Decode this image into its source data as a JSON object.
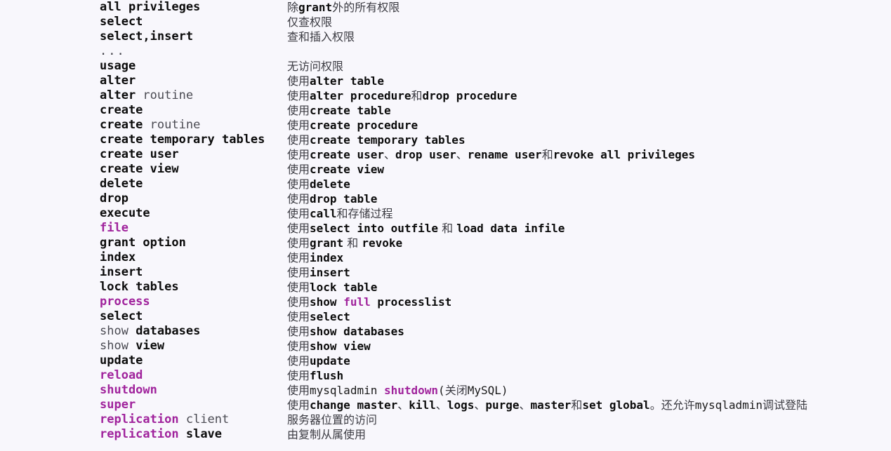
{
  "page": {
    "background_color": "#f8f7fc",
    "keyword_color": "#0b0b0b",
    "highlight_color": "#a0239c",
    "dim_color": "#4a4a52",
    "chinese_color": "#3b3b42"
  },
  "rows": [
    {
      "id": "all-privileges",
      "left_plain": "all privileges",
      "right_plain": "除grant外的所有权限",
      "left_parts": [
        {
          "text": "all privileges",
          "style": "kw"
        }
      ],
      "right_parts": [
        {
          "text": "除",
          "style": "cn"
        },
        {
          "text": "grant",
          "style": "kw"
        },
        {
          "text": "外的所有权限",
          "style": "cn"
        }
      ]
    },
    {
      "id": "select-top",
      "left_plain": "select",
      "right_plain": "仅查权限",
      "left_parts": [
        {
          "text": "select",
          "style": "kw"
        }
      ],
      "right_parts": [
        {
          "text": "仅查权限",
          "style": "cn"
        }
      ]
    },
    {
      "id": "select-insert",
      "left_plain": "select,insert",
      "right_plain": "查和插入权限",
      "left_parts": [
        {
          "text": "select,insert",
          "style": "kw"
        }
      ],
      "right_parts": [
        {
          "text": "查和插入权限",
          "style": "cn"
        }
      ]
    },
    {
      "id": "ellipsis",
      "left_plain": "...",
      "right_plain": "",
      "left_parts": [
        {
          "text": "...",
          "style": "ellipsis"
        }
      ],
      "right_parts": []
    },
    {
      "id": "usage",
      "left_plain": "usage",
      "right_plain": "无访问权限",
      "left_parts": [
        {
          "text": "usage",
          "style": "kw"
        }
      ],
      "right_parts": [
        {
          "text": "无访问权限",
          "style": "cn"
        }
      ]
    },
    {
      "id": "alter",
      "left_plain": "alter",
      "right_plain": "使用alter table",
      "left_parts": [
        {
          "text": "alter",
          "style": "kw"
        }
      ],
      "right_parts": [
        {
          "text": "使用",
          "style": "cn"
        },
        {
          "text": "alter table",
          "style": "kw"
        }
      ]
    },
    {
      "id": "alter-routine",
      "left_plain": "alter routine",
      "right_plain": "使用alter procedure和drop procedure",
      "left_parts": [
        {
          "text": "alter",
          "style": "kw"
        },
        {
          "text": " routine",
          "style": "dim"
        }
      ],
      "right_parts": [
        {
          "text": "使用",
          "style": "cn"
        },
        {
          "text": "alter procedure",
          "style": "kw"
        },
        {
          "text": "和",
          "style": "cn"
        },
        {
          "text": "drop procedure",
          "style": "kw"
        }
      ]
    },
    {
      "id": "create",
      "left_plain": "create",
      "right_plain": "使用create table",
      "left_parts": [
        {
          "text": "create",
          "style": "kw"
        }
      ],
      "right_parts": [
        {
          "text": "使用",
          "style": "cn"
        },
        {
          "text": "create table",
          "style": "kw"
        }
      ]
    },
    {
      "id": "create-routine",
      "left_plain": "create routine",
      "right_plain": "使用create procedure",
      "left_parts": [
        {
          "text": "create",
          "style": "kw"
        },
        {
          "text": " routine",
          "style": "dim"
        }
      ],
      "right_parts": [
        {
          "text": "使用",
          "style": "cn"
        },
        {
          "text": "create procedure",
          "style": "kw"
        }
      ]
    },
    {
      "id": "create-temporary-tables",
      "left_plain": "create temporary tables",
      "right_plain": "使用create temporary tables",
      "left_parts": [
        {
          "text": "create temporary tables",
          "style": "kw"
        }
      ],
      "right_parts": [
        {
          "text": "使用",
          "style": "cn"
        },
        {
          "text": "create temporary tables",
          "style": "kw"
        }
      ]
    },
    {
      "id": "create-user",
      "left_plain": "create user",
      "right_plain": "使用create user、drop user、rename user和revoke  all privileges",
      "left_parts": [
        {
          "text": "create user",
          "style": "kw"
        }
      ],
      "right_parts": [
        {
          "text": "使用",
          "style": "cn"
        },
        {
          "text": "create user",
          "style": "kw"
        },
        {
          "text": "、",
          "style": "cn"
        },
        {
          "text": "drop user",
          "style": "kw"
        },
        {
          "text": "、",
          "style": "cn"
        },
        {
          "text": "rename user",
          "style": "kw"
        },
        {
          "text": "和",
          "style": "cn"
        },
        {
          "text": "revoke  all privileges",
          "style": "kw"
        }
      ]
    },
    {
      "id": "create-view",
      "left_plain": "create view",
      "right_plain": "使用create view",
      "left_parts": [
        {
          "text": "create view",
          "style": "kw"
        }
      ],
      "right_parts": [
        {
          "text": "使用",
          "style": "cn"
        },
        {
          "text": "create view",
          "style": "kw"
        }
      ]
    },
    {
      "id": "delete",
      "left_plain": "delete",
      "right_plain": "使用delete",
      "left_parts": [
        {
          "text": "delete",
          "style": "kw"
        }
      ],
      "right_parts": [
        {
          "text": "使用",
          "style": "cn"
        },
        {
          "text": "delete",
          "style": "kw"
        }
      ]
    },
    {
      "id": "drop",
      "left_plain": "drop",
      "right_plain": "使用drop table",
      "left_parts": [
        {
          "text": "drop",
          "style": "kw"
        }
      ],
      "right_parts": [
        {
          "text": "使用",
          "style": "cn"
        },
        {
          "text": "drop table",
          "style": "kw"
        }
      ]
    },
    {
      "id": "execute",
      "left_plain": "execute",
      "right_plain": "使用call和存储过程",
      "left_parts": [
        {
          "text": "execute",
          "style": "kw"
        }
      ],
      "right_parts": [
        {
          "text": "使用",
          "style": "cn"
        },
        {
          "text": "call",
          "style": "kw"
        },
        {
          "text": "和存储过程",
          "style": "cn"
        }
      ]
    },
    {
      "id": "file",
      "left_plain": "file",
      "right_plain": "使用select into outfile 和 load data infile",
      "left_parts": [
        {
          "text": "file",
          "style": "purple"
        }
      ],
      "right_parts": [
        {
          "text": "使用",
          "style": "cn"
        },
        {
          "text": "select into outfile",
          "style": "kw"
        },
        {
          "text": " 和 ",
          "style": "cn"
        },
        {
          "text": "load data infile",
          "style": "kw"
        }
      ]
    },
    {
      "id": "grant-option",
      "left_plain": "grant option",
      "right_plain": "使用grant 和 revoke",
      "left_parts": [
        {
          "text": "grant option",
          "style": "kw"
        }
      ],
      "right_parts": [
        {
          "text": "使用",
          "style": "cn"
        },
        {
          "text": "grant",
          "style": "kw"
        },
        {
          "text": " 和 ",
          "style": "cn"
        },
        {
          "text": "revoke",
          "style": "kw"
        }
      ]
    },
    {
      "id": "index",
      "left_plain": "index",
      "right_plain": "使用index",
      "left_parts": [
        {
          "text": "index",
          "style": "kw"
        }
      ],
      "right_parts": [
        {
          "text": "使用",
          "style": "cn"
        },
        {
          "text": "index",
          "style": "kw"
        }
      ]
    },
    {
      "id": "insert",
      "left_plain": "insert",
      "right_plain": "使用insert",
      "left_parts": [
        {
          "text": "insert",
          "style": "kw"
        }
      ],
      "right_parts": [
        {
          "text": "使用",
          "style": "cn"
        },
        {
          "text": "insert",
          "style": "kw"
        }
      ]
    },
    {
      "id": "lock-tables",
      "left_plain": "lock tables",
      "right_plain": "使用lock table",
      "left_parts": [
        {
          "text": "lock tables",
          "style": "kw"
        }
      ],
      "right_parts": [
        {
          "text": "使用",
          "style": "cn"
        },
        {
          "text": "lock table",
          "style": "kw"
        }
      ]
    },
    {
      "id": "process",
      "left_plain": "process",
      "right_plain": "使用show full processlist",
      "left_parts": [
        {
          "text": "process",
          "style": "purple"
        }
      ],
      "right_parts": [
        {
          "text": "使用",
          "style": "cn"
        },
        {
          "text": "show ",
          "style": "kw"
        },
        {
          "text": "full",
          "style": "purple"
        },
        {
          "text": " processlist",
          "style": "kw"
        }
      ]
    },
    {
      "id": "select",
      "left_plain": "select",
      "right_plain": "使用select",
      "left_parts": [
        {
          "text": "select",
          "style": "kw"
        }
      ],
      "right_parts": [
        {
          "text": "使用",
          "style": "cn"
        },
        {
          "text": "select",
          "style": "kw"
        }
      ]
    },
    {
      "id": "show-databases",
      "left_plain": "show databases",
      "right_plain": "使用show databases",
      "left_parts": [
        {
          "text": "show ",
          "style": "dim"
        },
        {
          "text": "databases",
          "style": "kw"
        }
      ],
      "right_parts": [
        {
          "text": "使用",
          "style": "cn"
        },
        {
          "text": "show databases",
          "style": "kw"
        }
      ]
    },
    {
      "id": "show-view",
      "left_plain": "show view",
      "right_plain": "使用show view",
      "left_parts": [
        {
          "text": "show ",
          "style": "dim"
        },
        {
          "text": "view",
          "style": "kw"
        }
      ],
      "right_parts": [
        {
          "text": "使用",
          "style": "cn"
        },
        {
          "text": "show view",
          "style": "kw"
        }
      ]
    },
    {
      "id": "update",
      "left_plain": "update",
      "right_plain": "使用update",
      "left_parts": [
        {
          "text": "update",
          "style": "kw"
        }
      ],
      "right_parts": [
        {
          "text": "使用",
          "style": "cn"
        },
        {
          "text": "update",
          "style": "kw"
        }
      ]
    },
    {
      "id": "reload",
      "left_plain": "reload",
      "right_plain": "使用flush",
      "left_parts": [
        {
          "text": "reload",
          "style": "purple"
        }
      ],
      "right_parts": [
        {
          "text": "使用",
          "style": "cn"
        },
        {
          "text": "flush",
          "style": "kw"
        }
      ]
    },
    {
      "id": "shutdown",
      "left_plain": "shutdown",
      "right_plain": "使用mysqladmin shutdown(关闭MySQL)",
      "left_parts": [
        {
          "text": "shutdown",
          "style": "purple"
        }
      ],
      "right_parts": [
        {
          "text": "使用",
          "style": "cn"
        },
        {
          "text": "mysqladmin ",
          "style": "plain"
        },
        {
          "text": "shutdown",
          "style": "purple"
        },
        {
          "text": "(",
          "style": "plain"
        },
        {
          "text": "关闭",
          "style": "cn"
        },
        {
          "text": "MySQL)",
          "style": "plain"
        }
      ]
    },
    {
      "id": "super",
      "left_plain": "super",
      "right_plain": "使用change master、kill、logs、purge、master和set global。还允许mysqladmin调试登陆",
      "left_parts": [
        {
          "text": "super",
          "style": "purple"
        }
      ],
      "right_parts": [
        {
          "text": "使用",
          "style": "cn"
        },
        {
          "text": "change master",
          "style": "kw"
        },
        {
          "text": "、",
          "style": "cn"
        },
        {
          "text": "kill",
          "style": "kw"
        },
        {
          "text": "、",
          "style": "cn"
        },
        {
          "text": "logs",
          "style": "kw"
        },
        {
          "text": "、",
          "style": "cn"
        },
        {
          "text": "purge",
          "style": "kw"
        },
        {
          "text": "、",
          "style": "cn"
        },
        {
          "text": "master",
          "style": "kw"
        },
        {
          "text": "和",
          "style": "cn"
        },
        {
          "text": "set global",
          "style": "kw"
        },
        {
          "text": "。还允许",
          "style": "cn"
        },
        {
          "text": "mysqladmin",
          "style": "plain"
        },
        {
          "text": "调试登陆",
          "style": "cn"
        }
      ]
    },
    {
      "id": "replication-client",
      "left_plain": "replication client",
      "right_plain": "服务器位置的访问",
      "left_parts": [
        {
          "text": "replication",
          "style": "purple"
        },
        {
          "text": " client",
          "style": "dim"
        }
      ],
      "right_parts": [
        {
          "text": "服务器位置的访问",
          "style": "cn"
        }
      ]
    },
    {
      "id": "replication-slave",
      "left_plain": "replication slave",
      "right_plain": "由复制从属使用",
      "left_parts": [
        {
          "text": "replication",
          "style": "purple"
        },
        {
          "text": " ",
          "style": "dim"
        },
        {
          "text": "slave",
          "style": "kw"
        }
      ],
      "right_parts": [
        {
          "text": "由复制从属使用",
          "style": "cn"
        }
      ]
    }
  ]
}
